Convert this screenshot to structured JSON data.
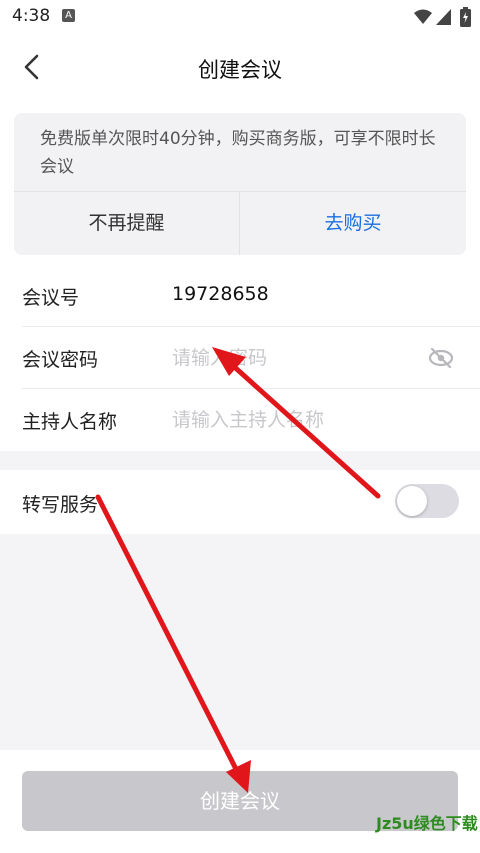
{
  "status_bar": {
    "time": "4:38",
    "notification_letter": "A"
  },
  "header": {
    "title": "创建会议"
  },
  "notice": {
    "text": "免费版单次限时40分钟，购买商务版，可享不限时长会议",
    "dismiss_label": "不再提醒",
    "buy_label": "去购买"
  },
  "form": {
    "meeting_id_label": "会议号",
    "meeting_id_value": "19728658",
    "password_label": "会议密码",
    "password_placeholder": "请输入密码",
    "host_label": "主持人名称",
    "host_placeholder": "请输入主持人名称"
  },
  "transcription": {
    "label": "转写服务",
    "enabled": false
  },
  "footer": {
    "create_label": "创建会议"
  },
  "watermark": {
    "text": "Jz5u绿色下载"
  },
  "colors": {
    "accent": "#1a6fe0",
    "annotation_arrow": "#e0161b"
  }
}
